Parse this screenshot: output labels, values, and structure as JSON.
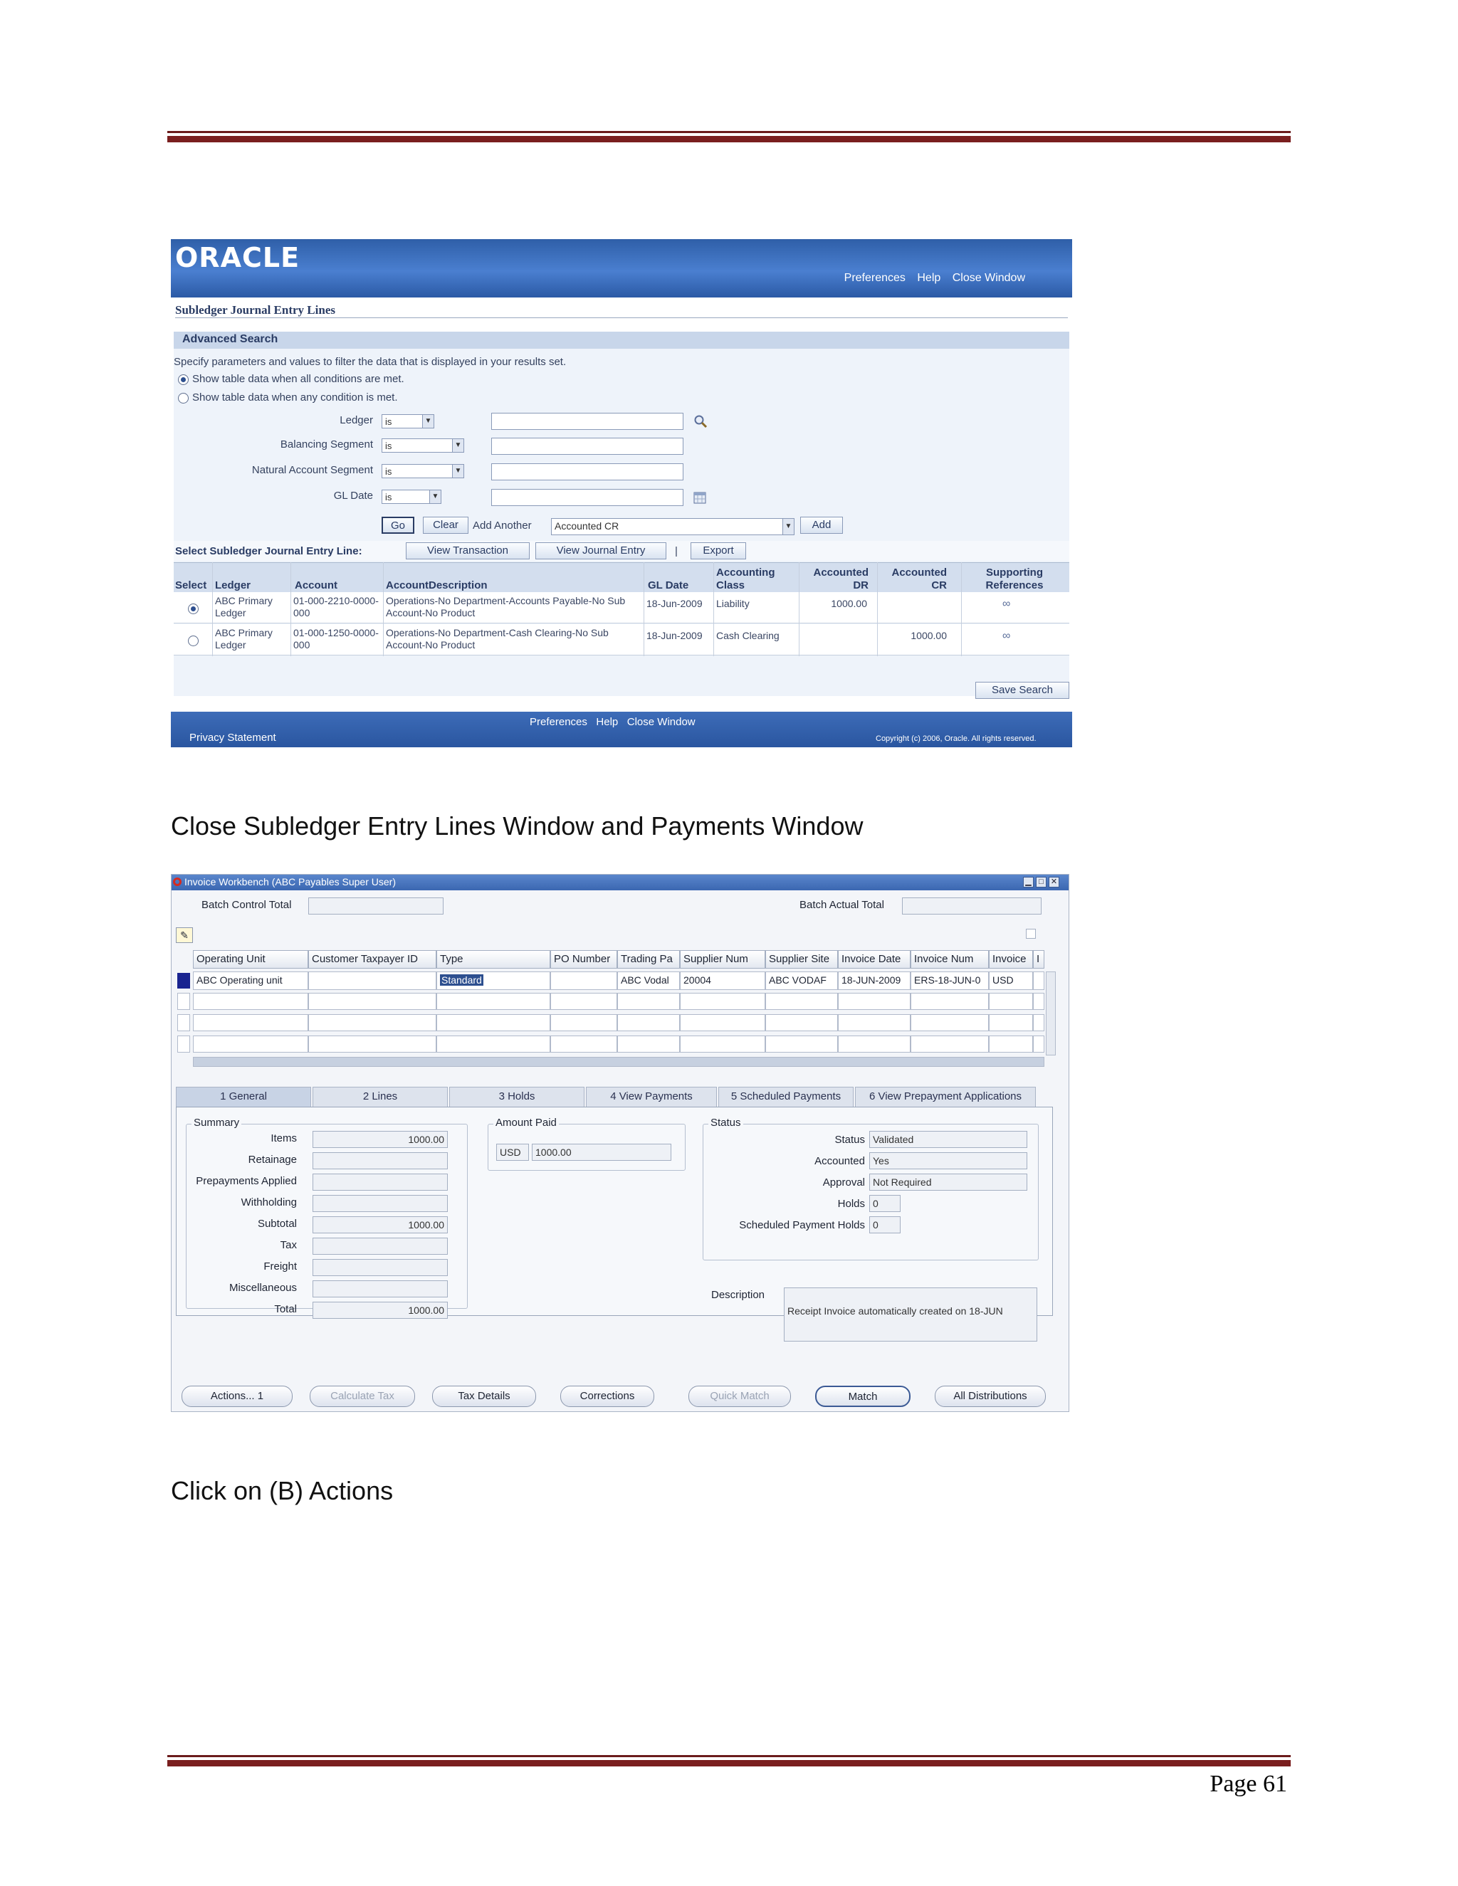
{
  "oracle_page": {
    "logo": "ORACLE",
    "header_links": [
      "Preferences",
      "Help",
      "Close Window"
    ],
    "page_title": "Subledger Journal Entry Lines",
    "advanced_search": {
      "heading": "Advanced Search",
      "intro": "Specify parameters and values to filter the data that is displayed in your results set.",
      "option_all": "Show table data when all conditions are met.",
      "option_any": "Show table data when any condition is met.",
      "fields": [
        {
          "label": "Ledger",
          "operator": "is"
        },
        {
          "label": "Balancing Segment",
          "operator": "is"
        },
        {
          "label": "Natural Account Segment",
          "operator": "is"
        },
        {
          "label": "GL Date",
          "operator": "is"
        }
      ],
      "go_label": "Go",
      "clear_label": "Clear",
      "add_another_label": "Add Another",
      "add_another_value": "Accounted CR",
      "add_label": "Add"
    },
    "select_line_label": "Select Subledger Journal Entry Line:",
    "view_transaction_label": "View Transaction",
    "view_journal_entry_label": "View Journal Entry",
    "separator": "|",
    "export_label": "Export",
    "columns": [
      "Select",
      "Ledger",
      "Account",
      "AccountDescription",
      "GL Date",
      "Accounting Class",
      "Accounted DR",
      "Accounted CR",
      "Supporting References"
    ],
    "rows": [
      {
        "ledger": "ABC Primary Ledger",
        "account": "01-000-2210-0000-000",
        "description": "Operations-No Department-Accounts Payable-No Sub Account-No Product",
        "gl_date": "18-Jun-2009",
        "class": "Liability",
        "dr": "1000.00",
        "cr": "",
        "ref": "∞",
        "selected": true
      },
      {
        "ledger": "ABC Primary Ledger",
        "account": "01-000-1250-0000-000",
        "description": "Operations-No Department-Cash Clearing-No Sub Account-No Product",
        "gl_date": "18-Jun-2009",
        "class": "Cash Clearing",
        "dr": "",
        "cr": "1000.00",
        "ref": "∞",
        "selected": false
      }
    ],
    "save_search_label": "Save Search",
    "footer_links": [
      "Preferences",
      "Help",
      "Close Window"
    ],
    "privacy": "Privacy Statement",
    "copyright": "Copyright (c) 2006, Oracle. All rights reserved."
  },
  "doc": {
    "caption_1": "Close Subledger Entry Lines Window and Payments Window",
    "caption_2": "Click on (B) Actions",
    "page_number": "Page 61"
  },
  "workbench": {
    "window_title": "Invoice Workbench (ABC Payables Super User)",
    "batch_control_total_label": "Batch Control Total",
    "batch_actual_total_label": "Batch Actual Total",
    "columns": [
      "Operating Unit",
      "Customer Taxpayer ID",
      "Type",
      "PO Number",
      "Trading Pa",
      "Supplier Num",
      "Supplier Site",
      "Invoice Date",
      "Invoice Num",
      "Invoice",
      "I"
    ],
    "row": [
      "ABC Operating unit",
      "",
      "Standard",
      "",
      "ABC Vodal",
      "20004",
      "ABC VODAF",
      "18-JUN-2009",
      "ERS-18-JUN-0",
      "USD",
      ""
    ],
    "tabs": [
      "1 General",
      "2 Lines",
      "3 Holds",
      "4 View Payments",
      "5 Scheduled Payments",
      "6 View Prepayment Applications"
    ],
    "summary": {
      "title": "Summary",
      "fields": [
        {
          "label": "Items",
          "value": "1000.00"
        },
        {
          "label": "Retainage",
          "value": ""
        },
        {
          "label": "Prepayments Applied",
          "value": ""
        },
        {
          "label": "Withholding",
          "value": ""
        },
        {
          "label": "Subtotal",
          "value": "1000.00"
        },
        {
          "label": "Tax",
          "value": ""
        },
        {
          "label": "Freight",
          "value": ""
        },
        {
          "label": "Miscellaneous",
          "value": ""
        },
        {
          "label": "Total",
          "value": "1000.00"
        }
      ]
    },
    "amount_paid": {
      "title": "Amount Paid",
      "currency": "USD",
      "value": "1000.00"
    },
    "status": {
      "title": "Status",
      "fields": [
        {
          "label": "Status",
          "value": "Validated"
        },
        {
          "label": "Accounted",
          "value": "Yes"
        },
        {
          "label": "Approval",
          "value": "Not Required"
        },
        {
          "label": "Holds",
          "value": "0"
        },
        {
          "label": "Scheduled Payment Holds",
          "value": "0"
        }
      ]
    },
    "description_label": "Description",
    "description_value": "Receipt Invoice automatically created on 18-JUN",
    "buttons": [
      "Actions... 1",
      "Calculate Tax",
      "Tax Details",
      "Corrections",
      "Quick Match",
      "Match",
      "All Distributions"
    ]
  }
}
